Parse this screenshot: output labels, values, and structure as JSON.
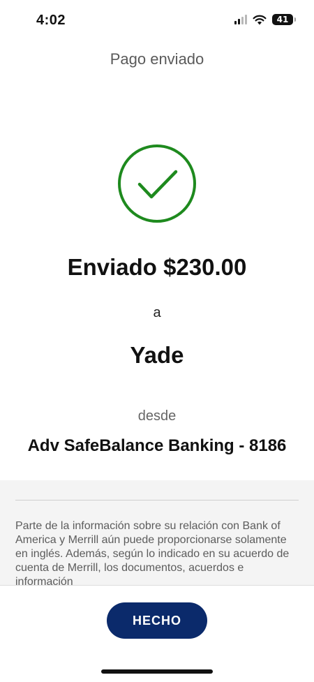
{
  "status_bar": {
    "time": "4:02",
    "battery_level": "41",
    "icons": [
      "signal-icon",
      "wifi-icon",
      "battery-icon"
    ]
  },
  "header": {
    "title": "Pago enviado"
  },
  "confirmation": {
    "icon": "checkmark-circle-icon",
    "icon_color": "#1e8a1e",
    "amount_line": "Enviado $230.00",
    "to_word": "a",
    "recipient": "Yade",
    "from_word": "desde",
    "account": "Adv SafeBalance Banking - 8186"
  },
  "disclaimer": {
    "text": "Parte de la información sobre su relación con Bank of America y Merrill aún puede proporcionarse solamente en inglés. Además, según lo indicado en su acuerdo de cuenta de Merrill, los documentos, acuerdos e información"
  },
  "footer": {
    "done_label": "HECHO",
    "button_color": "#0b2a6b"
  }
}
